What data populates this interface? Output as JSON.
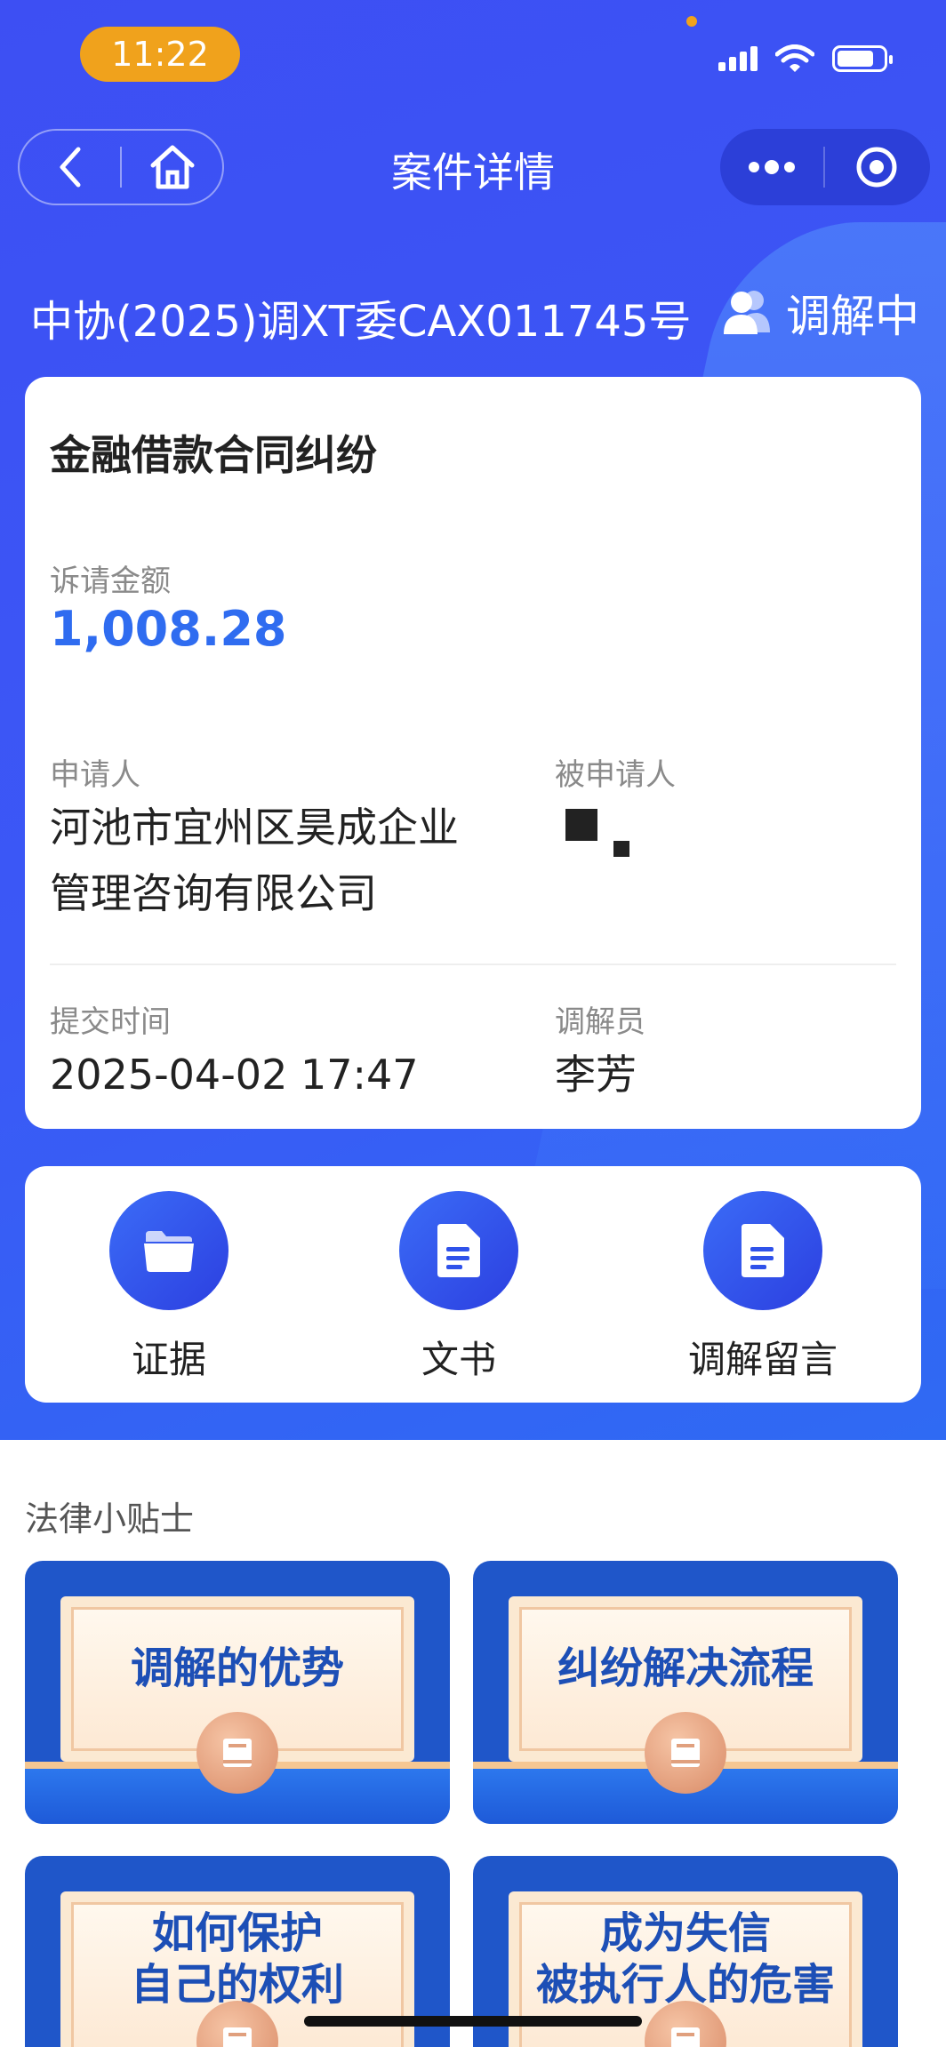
{
  "status_bar": {
    "time": "11:22"
  },
  "nav": {
    "title": "案件详情",
    "back_icon": "back-icon",
    "home_icon": "home-icon",
    "more_icon": "more-icon",
    "close_icon": "target-icon"
  },
  "case": {
    "number": "中协(2025)调XT委CAX011745号",
    "status": "调解中"
  },
  "detail": {
    "title": "金融借款合同纠纷",
    "amount_label": "诉请金额",
    "amount": "1,008.28",
    "applicant_label": "申请人",
    "applicant_line1": "河池市宜州区昊成企业",
    "applicant_line2": "管理咨询有限公司",
    "respondent_label": "被申请人",
    "submit_time_label": "提交时间",
    "submit_time": "2025-04-02 17:47",
    "mediator_label": "调解员",
    "mediator": "李芳"
  },
  "actions": [
    {
      "label": "证据",
      "icon": "folder-icon"
    },
    {
      "label": "文书",
      "icon": "document-icon"
    },
    {
      "label": "调解留言",
      "icon": "message-document-icon"
    }
  ],
  "tips": {
    "section_title": "法律小贴士",
    "items": [
      {
        "line1": "调解的优势",
        "line2": ""
      },
      {
        "line1": "纠纷解决流程",
        "line2": ""
      },
      {
        "line1": "如何保护",
        "line2": "自己的权利"
      },
      {
        "line1": "成为失信",
        "line2": "被执行人的危害"
      }
    ]
  },
  "colors": {
    "brand_blue": "#3b50f5",
    "amount_blue": "#2f6cf0",
    "badge_orange": "#f0a21c"
  }
}
